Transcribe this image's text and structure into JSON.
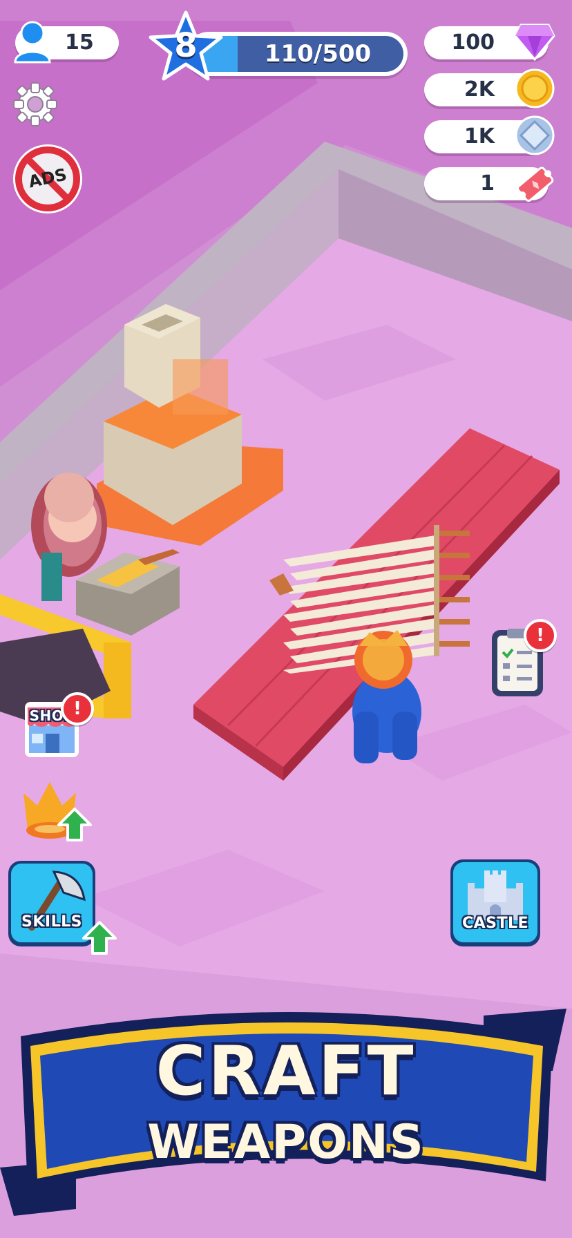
{
  "hud": {
    "players_count": "15",
    "level": "8",
    "xp_text": "110/500",
    "xp_progress": 0.22,
    "gems": "100",
    "coins": "2K",
    "silver": "1K",
    "tickets": "1"
  },
  "buttons": {
    "ads_label": "ADS",
    "shop_label": "SHOP",
    "skills_label": "SKILLS",
    "castle_label": "CASTLE",
    "alert_mark": "!"
  },
  "banner": {
    "line1": "CRAFT",
    "line2": "WEAPONS"
  },
  "colors": {
    "floor": "#e3a6e4",
    "wall": "#c58fc9",
    "gem": "#c25bf0",
    "coin": "#f6b81c",
    "bench": "#d8455f",
    "banner_blue": "#1f49b5",
    "banner_gold": "#f5c529",
    "xp_bar": "#3aa6f2"
  },
  "icons": [
    "player-icon",
    "gear-icon",
    "no-ads-icon",
    "star-level-icon",
    "gem-icon",
    "coin-icon",
    "silver-icon",
    "ticket-icon",
    "shop-icon",
    "crown-upgrade-icon",
    "up-arrow-icon",
    "axe-icon",
    "castle-icon",
    "quest-clipboard-icon"
  ]
}
